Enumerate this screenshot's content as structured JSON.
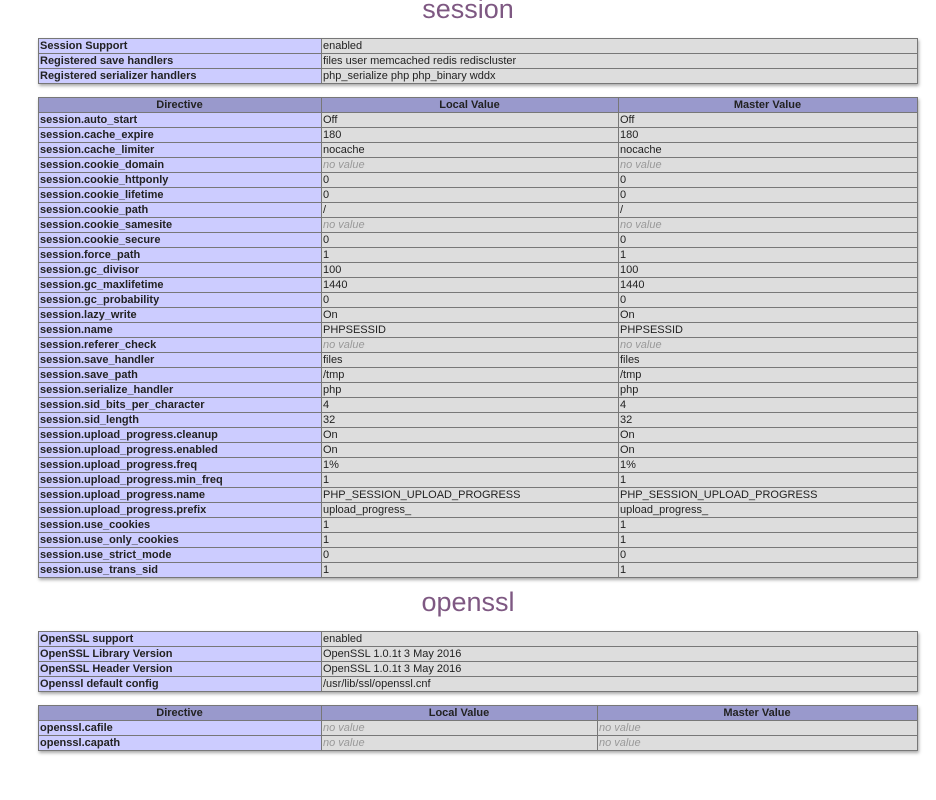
{
  "session": {
    "title": "session",
    "info": [
      {
        "k": "Session Support",
        "v": "enabled"
      },
      {
        "k": "Registered save handlers",
        "v": "files user memcached redis rediscluster"
      },
      {
        "k": "Registered serializer handlers",
        "v": "php_serialize php php_binary wddx"
      }
    ],
    "headers": {
      "directive": "Directive",
      "local": "Local Value",
      "master": "Master Value"
    },
    "directives": [
      {
        "name": "session.auto_start",
        "local": "Off",
        "master": "Off"
      },
      {
        "name": "session.cache_expire",
        "local": "180",
        "master": "180"
      },
      {
        "name": "session.cache_limiter",
        "local": "nocache",
        "master": "nocache"
      },
      {
        "name": "session.cookie_domain",
        "local": "no value",
        "master": "no value",
        "novalue": true
      },
      {
        "name": "session.cookie_httponly",
        "local": "0",
        "master": "0"
      },
      {
        "name": "session.cookie_lifetime",
        "local": "0",
        "master": "0"
      },
      {
        "name": "session.cookie_path",
        "local": "/",
        "master": "/"
      },
      {
        "name": "session.cookie_samesite",
        "local": "no value",
        "master": "no value",
        "novalue": true
      },
      {
        "name": "session.cookie_secure",
        "local": "0",
        "master": "0"
      },
      {
        "name": "session.force_path",
        "local": "1",
        "master": "1"
      },
      {
        "name": "session.gc_divisor",
        "local": "100",
        "master": "100"
      },
      {
        "name": "session.gc_maxlifetime",
        "local": "1440",
        "master": "1440"
      },
      {
        "name": "session.gc_probability",
        "local": "0",
        "master": "0"
      },
      {
        "name": "session.lazy_write",
        "local": "On",
        "master": "On"
      },
      {
        "name": "session.name",
        "local": "PHPSESSID",
        "master": "PHPSESSID"
      },
      {
        "name": "session.referer_check",
        "local": "no value",
        "master": "no value",
        "novalue": true
      },
      {
        "name": "session.save_handler",
        "local": "files",
        "master": "files"
      },
      {
        "name": "session.save_path",
        "local": "/tmp",
        "master": "/tmp"
      },
      {
        "name": "session.serialize_handler",
        "local": "php",
        "master": "php"
      },
      {
        "name": "session.sid_bits_per_character",
        "local": "4",
        "master": "4"
      },
      {
        "name": "session.sid_length",
        "local": "32",
        "master": "32"
      },
      {
        "name": "session.upload_progress.cleanup",
        "local": "On",
        "master": "On"
      },
      {
        "name": "session.upload_progress.enabled",
        "local": "On",
        "master": "On"
      },
      {
        "name": "session.upload_progress.freq",
        "local": "1%",
        "master": "1%"
      },
      {
        "name": "session.upload_progress.min_freq",
        "local": "1",
        "master": "1"
      },
      {
        "name": "session.upload_progress.name",
        "local": "PHP_SESSION_UPLOAD_PROGRESS",
        "master": "PHP_SESSION_UPLOAD_PROGRESS"
      },
      {
        "name": "session.upload_progress.prefix",
        "local": "upload_progress_",
        "master": "upload_progress_"
      },
      {
        "name": "session.use_cookies",
        "local": "1",
        "master": "1"
      },
      {
        "name": "session.use_only_cookies",
        "local": "1",
        "master": "1"
      },
      {
        "name": "session.use_strict_mode",
        "local": "0",
        "master": "0"
      },
      {
        "name": "session.use_trans_sid",
        "local": "1",
        "master": "1"
      }
    ]
  },
  "openssl": {
    "title": "openssl",
    "info": [
      {
        "k": "OpenSSL support",
        "v": "enabled"
      },
      {
        "k": "OpenSSL Library Version",
        "v": "OpenSSL 1.0.1t 3 May 2016"
      },
      {
        "k": "OpenSSL Header Version",
        "v": "OpenSSL 1.0.1t 3 May 2016"
      },
      {
        "k": "Openssl default config",
        "v": "/usr/lib/ssl/openssl.cnf"
      }
    ],
    "headers": {
      "directive": "Directive",
      "local": "Local Value",
      "master": "Master Value"
    },
    "directives": [
      {
        "name": "openssl.cafile",
        "local": "no value",
        "master": "no value",
        "novalue": true
      },
      {
        "name": "openssl.capath",
        "local": "no value",
        "master": "no value",
        "novalue": true
      }
    ]
  },
  "colors": {
    "title": "#7e5882",
    "header_bg": "#9999cc",
    "key_bg": "#ccccff",
    "value_bg": "#dddddd",
    "novalue_text": "#999999"
  }
}
